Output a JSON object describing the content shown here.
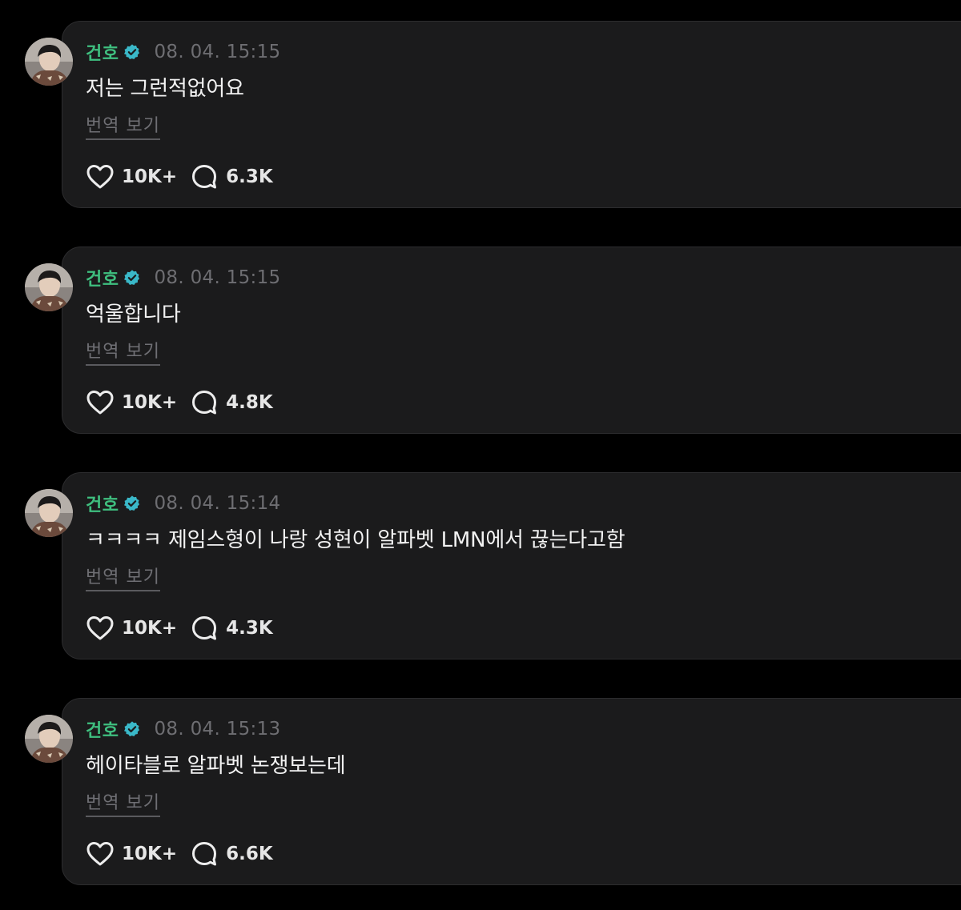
{
  "posts": [
    {
      "username": "건호",
      "verified_icon": "verified-badge-icon",
      "timestamp": "08. 04. 15:15",
      "message": "저는 그런적없어요",
      "translate_label": "번역 보기",
      "likes": "10K+",
      "comments": "6.3K"
    },
    {
      "username": "건호",
      "verified_icon": "verified-badge-icon",
      "timestamp": "08. 04. 15:15",
      "message": "억울합니다",
      "translate_label": "번역 보기",
      "likes": "10K+",
      "comments": "4.8K"
    },
    {
      "username": "건호",
      "verified_icon": "verified-badge-icon",
      "timestamp": "08. 04. 15:14",
      "message": "ㅋㅋㅋㅋ 제임스형이 나랑 성현이 알파벳 LMN에서 끊는다고함",
      "translate_label": "번역 보기",
      "likes": "10K+",
      "comments": "4.3K"
    },
    {
      "username": "건호",
      "verified_icon": "verified-badge-icon",
      "timestamp": "08. 04. 15:13",
      "message": "헤이타블로 알파벳 논쟁보는데",
      "translate_label": "번역 보기",
      "likes": "10K+",
      "comments": "6.6K"
    }
  ],
  "colors": {
    "background": "#000000",
    "card": "#1b1b1c",
    "username": "#3fbf7f",
    "verified": "#3ab8c8",
    "timestamp": "#6e6e72",
    "message": "#f2f2f2",
    "translate": "#6f6f74",
    "count": "#e6e6e6"
  }
}
